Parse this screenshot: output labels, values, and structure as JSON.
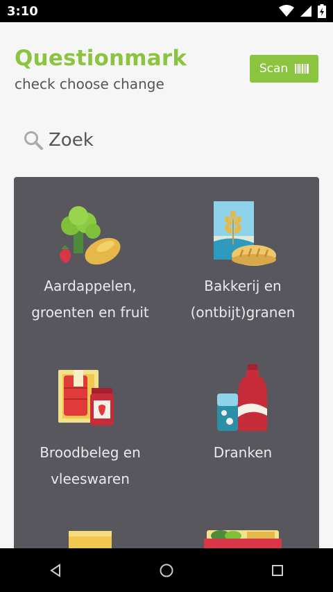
{
  "status_bar": {
    "time": "3:10"
  },
  "header": {
    "title": "Questionmark",
    "subtitle": "check choose change",
    "scan_label": "Scan"
  },
  "search": {
    "placeholder": "Zoek"
  },
  "categories": [
    {
      "line1": "Aardappelen,",
      "line2": "groenten en fruit"
    },
    {
      "line1": "Bakkerij en",
      "line2": "(ontbijt)granen"
    },
    {
      "line1": "Broodbeleg en",
      "line2": "vleeswaren"
    },
    {
      "line1": "Dranken",
      "line2": ""
    }
  ],
  "colors": {
    "brand": "#8bc53f",
    "panel": "#58575e"
  },
  "icons": {
    "wifi": "wifi-icon",
    "signal": "cell-signal-icon",
    "battery": "battery-icon",
    "search": "search-icon",
    "barcode": "barcode-icon",
    "back": "back-icon",
    "home": "home-icon",
    "recents": "recents-icon"
  }
}
